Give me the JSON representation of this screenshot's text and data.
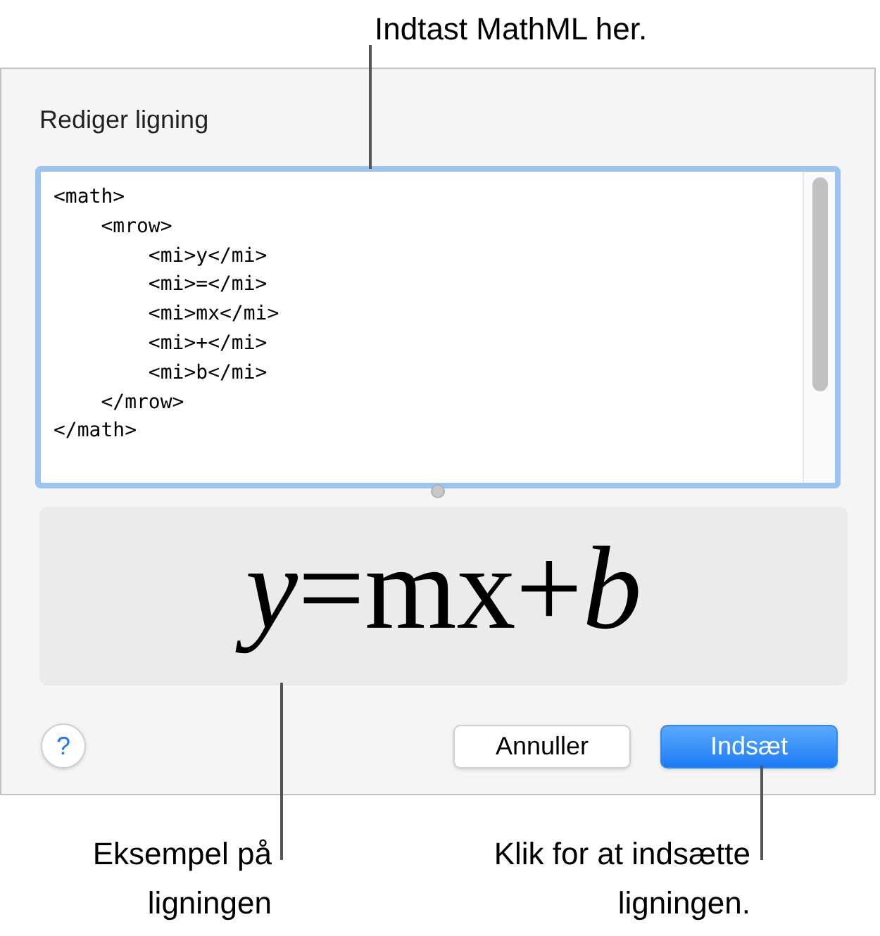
{
  "callout_top": "Indtast MathML her.",
  "dialog": {
    "title": "Rediger ligning",
    "code": "<math>\n    <mrow>\n        <mi>y</mi>\n        <mi>=</mi>\n        <mi>mx</mi>\n        <mi>+</mi>\n        <mi>b</mi>\n    </mrow>\n</math>",
    "preview": "*y*=mx+*b*",
    "help": "?",
    "buttons": [
      {
        "label": "Annuller",
        "kind": "secondary"
      },
      {
        "label": "Indsæt",
        "kind": "primary"
      }
    ]
  },
  "callouts_bottom": [
    {
      "text": "Eksempel på ligningen"
    },
    {
      "text": "Klik for at indsætte ligningen."
    }
  ]
}
